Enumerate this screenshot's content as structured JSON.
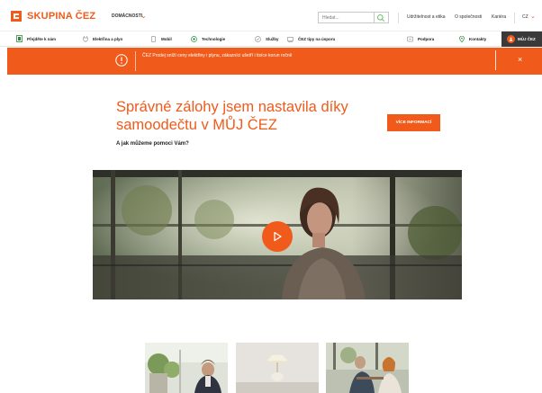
{
  "header": {
    "logo_text": "SKUPINA ČEZ",
    "segment": "DOMÁCNOSTI",
    "search_placeholder": "Hledat...",
    "links": [
      "Udržitelnost a etika",
      "O společnosti",
      "Kariéra"
    ],
    "language": "CZ"
  },
  "nav": {
    "items": [
      {
        "label": "Přejděte k nám",
        "icon": "switch-icon"
      },
      {
        "label": "Elektřina a plyn",
        "icon": "plug-icon"
      },
      {
        "label": "Mobil",
        "icon": "mobile-icon"
      },
      {
        "label": "Technologie",
        "icon": "technology-icon"
      },
      {
        "label": "Služby",
        "icon": "services-icon"
      },
      {
        "label": "ČEZ tipy na úsporu",
        "icon": "savings-icon"
      },
      {
        "label": "Podpora",
        "icon": "support-icon"
      },
      {
        "label": "Kontakty",
        "icon": "location-pin-icon"
      }
    ],
    "account_label": "MŮJ ČEZ"
  },
  "alert": {
    "text": "ČEZ Prodej sníží ceny elektřiny i plynu, zákazníci ušetří i tisíce korun ročně",
    "close_label": "×"
  },
  "hero": {
    "title": "Správné zálohy jsem nastavila díky samoodečtu v MŮJ ČEZ",
    "subtitle": "A jak můžeme pomoci Vám?",
    "cta_label": "VÍCE INFORMACÍ"
  },
  "colors": {
    "accent": "#f05a1a",
    "dark": "#3a3a3a"
  }
}
